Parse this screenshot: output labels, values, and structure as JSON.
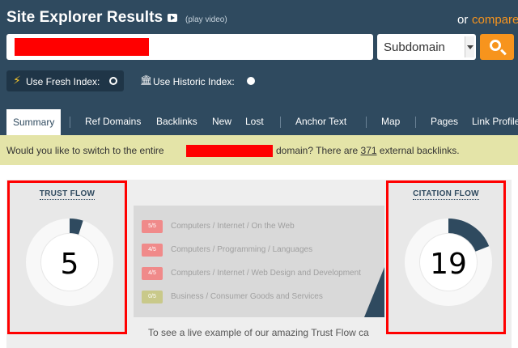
{
  "header": {
    "title": "Site Explorer Results",
    "play_video": "(play video)",
    "or_text": "or",
    "compare_link": "compare"
  },
  "search": {
    "value": "",
    "scope": "Subdomain"
  },
  "index_options": {
    "fresh_label": "Use Fresh Index:",
    "historic_label": "Use Historic Index:"
  },
  "tabs": [
    {
      "label": "Summary"
    },
    {
      "label": "Ref Domains"
    },
    {
      "label": "Backlinks"
    },
    {
      "label": "New"
    },
    {
      "label": "Lost"
    },
    {
      "label": "Anchor Text"
    },
    {
      "label": "Map"
    },
    {
      "label": "Pages"
    },
    {
      "label": "Link Profile"
    }
  ],
  "notice": {
    "before": "Would you like to switch to the entire",
    "after": "domain? There are",
    "count": "371",
    "tail": "external backlinks."
  },
  "trust_flow": {
    "title": "TRUST FLOW",
    "value": "5",
    "fraction": 0.05
  },
  "citation_flow": {
    "title": "CITATION FLOW",
    "value": "19",
    "fraction": 0.19
  },
  "topics": [
    {
      "badge": "5/5",
      "label": "Computers / Internet / On the Web",
      "color": "#f08a8a"
    },
    {
      "badge": "4/5",
      "label": "Computers / Programming / Languages",
      "color": "#f08a8a"
    },
    {
      "badge": "4/5",
      "label": "Computers / Internet / Web Design and Development",
      "color": "#f08a8a"
    },
    {
      "badge": "0/5",
      "label": "Business / Consumer Goods and Services",
      "color": "#c9c98a"
    }
  ],
  "live_example": "To see a live example of our amazing Trust Flow ca",
  "colors": {
    "header_bg": "#2f4a5f",
    "accent": "#f7941d",
    "notice_bg": "#e4e4a8",
    "gauge_fill": "#2f4a5f",
    "redaction": "#ff0000"
  }
}
